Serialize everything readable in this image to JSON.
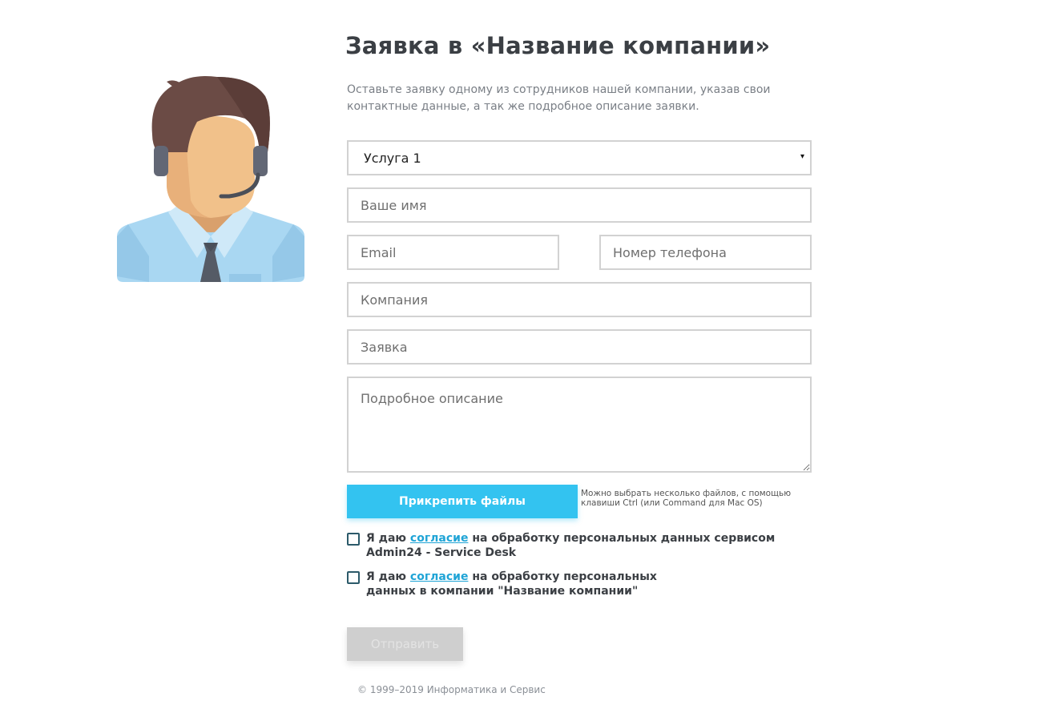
{
  "header": {
    "title": "Заявка в «Название компании»",
    "subtitle": "Оставьте заявку одному из сотрудников нашей компании, указав свои контактные данные, а так же подробное описание заявки."
  },
  "form": {
    "service_select": {
      "value": "Услуга 1",
      "caret": "▾"
    },
    "name_placeholder": "Ваше имя",
    "email_placeholder": "Email",
    "phone_placeholder": "Номер телефона",
    "company_placeholder": "Компания",
    "request_placeholder": "Заявка",
    "description_placeholder": "Подробное описание",
    "attach_label": "Прикрепить файлы",
    "attach_note": "Можно выбрать несколько файлов, с помощью клавиши Ctrl (или Command для Mac OS)",
    "consent1": {
      "prefix": "Я даю ",
      "link": "согласие",
      "suffix": " на обработку персональных данных сервисом Admin24 - Service Desk"
    },
    "consent2": {
      "prefix": "Я даю ",
      "link": "согласие",
      "suffix": " на обработку персональных данных в компании \"Название компании\""
    },
    "submit_label": "Отправить"
  },
  "footer": {
    "text": "© 1999–2019 Информатика и Сервис"
  },
  "colors": {
    "accent": "#33c3f0",
    "link": "#1fa4d6",
    "disabled_button": "#cfcfcf"
  },
  "icons": {
    "avatar": "support-agent-avatar-icon",
    "select_caret": "chevron-down-icon"
  }
}
